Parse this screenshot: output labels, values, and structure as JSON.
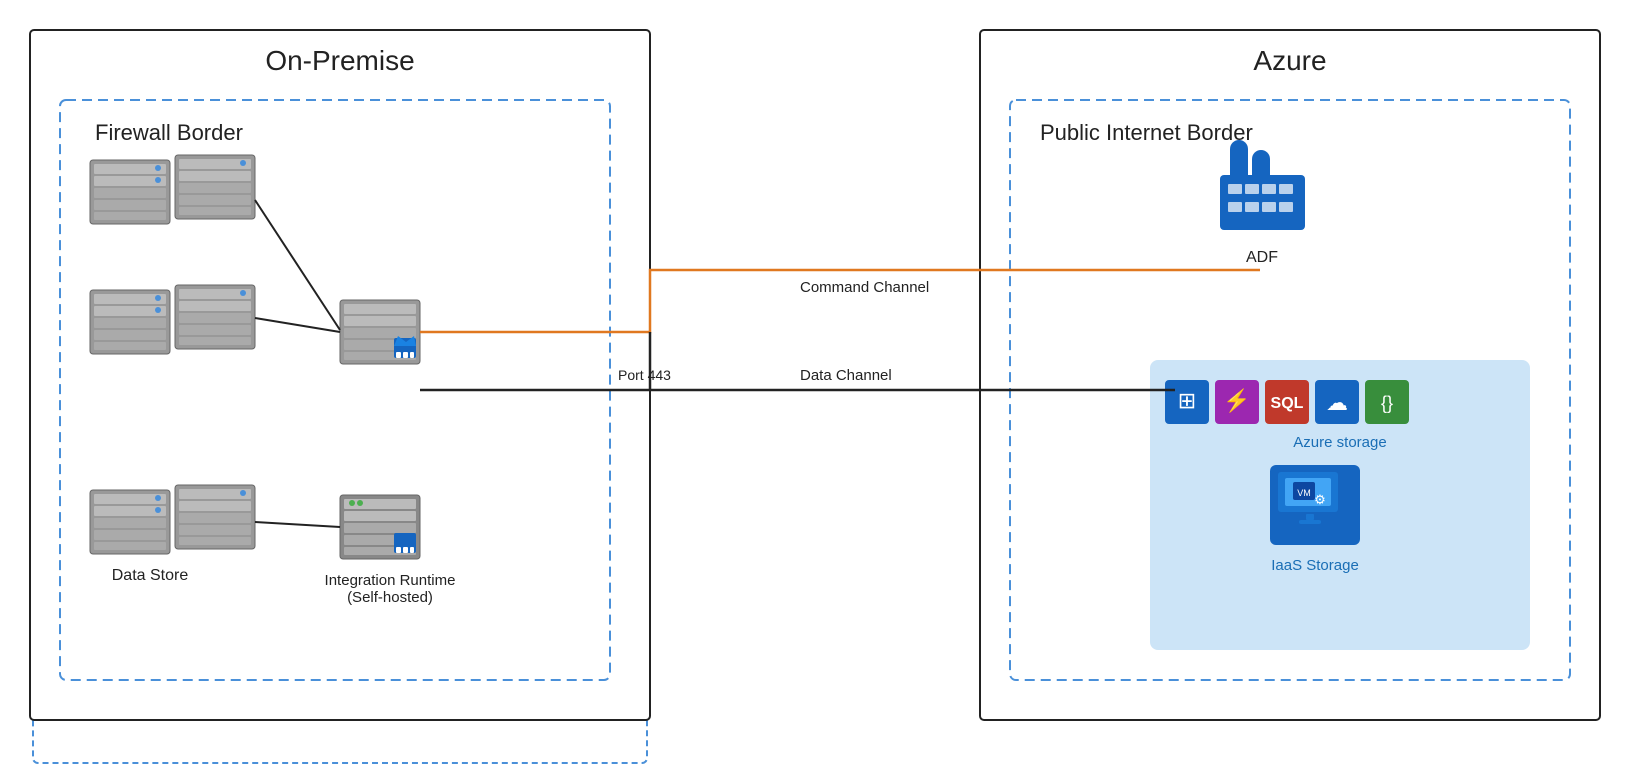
{
  "diagram": {
    "title_onpremise": "On-Premise",
    "title_azure": "Azure",
    "firewall_border_label": "Firewall Border",
    "public_internet_border_label": "Public Internet Border",
    "command_channel_label": "Command Channel",
    "data_channel_label": "Data Channel",
    "port_label": "Port 443",
    "adf_label": "ADF",
    "data_store_label": "Data Store",
    "integration_runtime_label": "Integration Runtime\n(Self-hosted)",
    "azure_storage_label": "Azure storage",
    "iaas_storage_label": "IaaS Storage",
    "colors": {
      "border_dark": "#222222",
      "border_dashed": "#4a90d9",
      "command_channel_line": "#e07820",
      "data_channel_line": "#222222",
      "azure_blue": "#1a6eb5",
      "adf_blue": "#1565c0",
      "storage_bg": "#cce4f7"
    },
    "storage_icons": [
      {
        "label": "grid",
        "color": "#1565c0",
        "symbol": "⊞"
      },
      {
        "label": "flash",
        "color": "#e040fb",
        "symbol": "⚡"
      },
      {
        "label": "sql",
        "color": "#c0392b",
        "symbol": "SQL"
      },
      {
        "label": "cloud",
        "color": "#1565c0",
        "symbol": "☁"
      },
      {
        "label": "json",
        "color": "#2e7d32",
        "symbol": "{}"
      }
    ]
  }
}
